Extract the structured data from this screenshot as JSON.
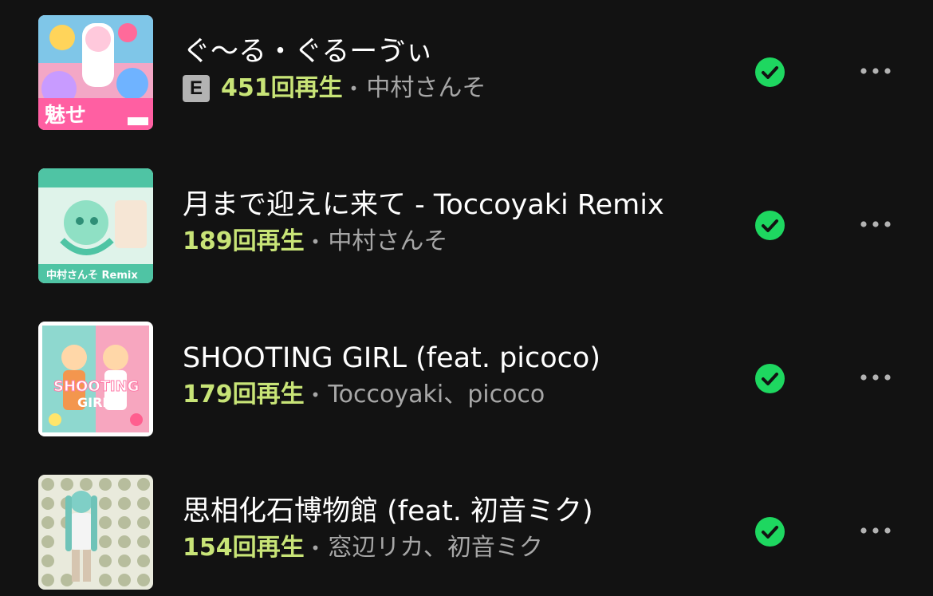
{
  "tracks": [
    {
      "title": "ぐ〜る・ぐるーゔぃ",
      "explicit": true,
      "explicit_label": "E",
      "plays": "451回再生",
      "separator": "•",
      "artist": "中村さんそ",
      "cover_icon": "album-cover-pink-collage"
    },
    {
      "title": "月まで迎えに来て - Toccoyaki Remix",
      "explicit": false,
      "plays": "189回再生",
      "separator": "•",
      "artist": "中村さんそ",
      "cover_icon": "album-cover-mint-girl"
    },
    {
      "title": "SHOOTING GIRL (feat. picoco)",
      "explicit": false,
      "plays": "179回再生",
      "separator": "•",
      "artist": "Toccoyaki、picoco",
      "cover_icon": "album-cover-shooting-girl"
    },
    {
      "title": "思相化石博物館 (feat. 初音ミク)",
      "explicit": false,
      "plays": "154回再生",
      "separator": "•",
      "artist": "窓辺リカ、初音ミク",
      "cover_icon": "album-cover-fossil-grid"
    }
  ],
  "colors": {
    "background": "#121212",
    "title": "#ffffff",
    "play_count": "#c8e477",
    "artist": "#a7a7a7",
    "downloaded": "#1ed760",
    "more_dots": "#b3b3b3"
  },
  "icons": {
    "downloaded": "downloaded-check-icon",
    "more": "more-options-icon"
  }
}
